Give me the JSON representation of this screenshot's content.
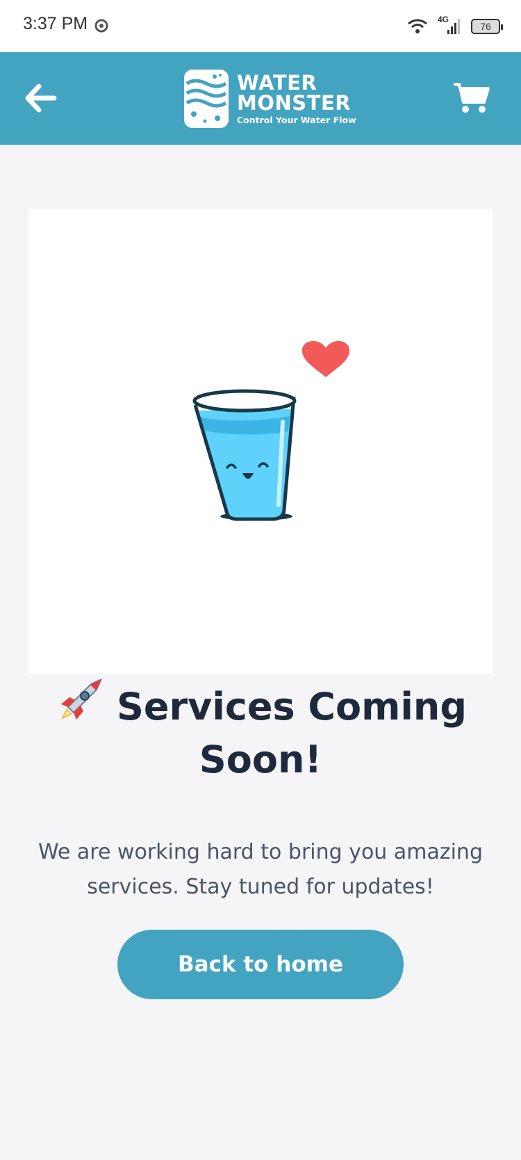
{
  "status_bar": {
    "time": "3:37 PM",
    "network": "4G",
    "battery": "76",
    "icons": [
      "chrome-icon",
      "wifi-icon",
      "signal-icon",
      "battery-icon"
    ]
  },
  "header": {
    "brand_line1": "WATER",
    "brand_line2": "MONSTER",
    "brand_tagline": "Control Your Water Flow",
    "back_icon": "arrow-left-icon",
    "cart_icon": "cart-icon",
    "color": "#43a4c2"
  },
  "content": {
    "illustration": "smiling-water-glass-with-heart",
    "title": "Services Coming Soon!",
    "title_icon": "rocket-icon",
    "description": "We are working hard to bring you amazing services. Stay tuned for updates!",
    "button_label": "Back to home"
  }
}
